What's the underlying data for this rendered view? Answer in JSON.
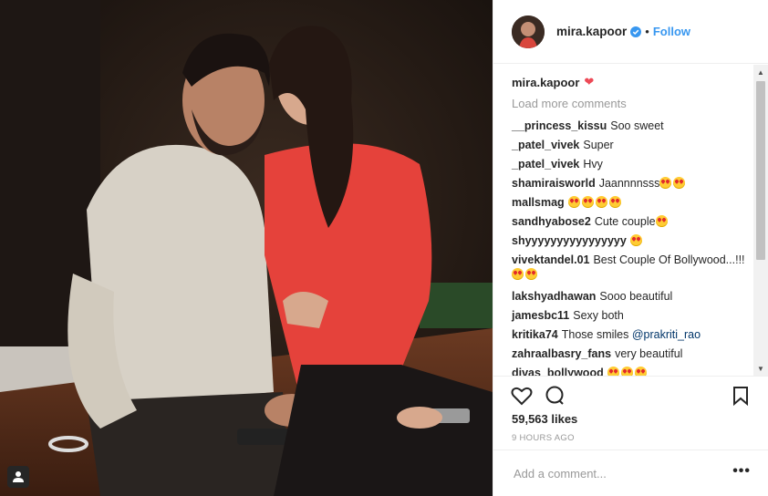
{
  "post": {
    "username": "mira.kapoor",
    "follow_label": "Follow",
    "separator": "•",
    "caption_user": "mira.kapoor",
    "load_more": "Load more comments",
    "comments": [
      {
        "user": "__princess_kissu",
        "text": "Soo sweet",
        "emoji": 0
      },
      {
        "user": "_patel_vivek",
        "text": "Super",
        "emoji": 0
      },
      {
        "user": "_patel_vivek",
        "text": "Hvy",
        "emoji": 0
      },
      {
        "user": "shamiraisworld",
        "text": "Jaannnnsss",
        "emoji": 2
      },
      {
        "user": "mallsmag",
        "text": "",
        "emoji": 4
      },
      {
        "user": "sandhyabose2",
        "text": "Cute couple",
        "emoji": 1
      },
      {
        "user": "shyyyyyyyyyyyyyyyy",
        "text": "",
        "emoji": 1
      },
      {
        "user": "vivektandel.01",
        "text": "Best Couple Of Bollywood...!!!",
        "emoji": 2
      },
      {
        "user": "lakshyadhawan",
        "text": "Sooo beautiful",
        "emoji": 0
      },
      {
        "user": "jamesbc11",
        "text": "Sexy both",
        "emoji": 0
      },
      {
        "user": "kritika74",
        "text": "Those smiles ",
        "mention": "@prakriti_rao",
        "emoji": 0
      },
      {
        "user": "zahraalbasry_fans",
        "text": "very beautiful",
        "emoji": 0
      },
      {
        "user": "divas_bollywood",
        "text": "",
        "emoji": 3
      }
    ],
    "likes": "59,563 likes",
    "time": "9 HOURS AGO",
    "add_comment_placeholder": "Add a comment...",
    "more_label": "•••"
  },
  "colors": {
    "accent": "#3897f0",
    "heart": "#ed4956",
    "text": "#262626",
    "muted": "#999999"
  },
  "icons": [
    "tag-user-icon",
    "verified-badge-icon",
    "heart-icon",
    "comment-icon",
    "bookmark-icon"
  ]
}
